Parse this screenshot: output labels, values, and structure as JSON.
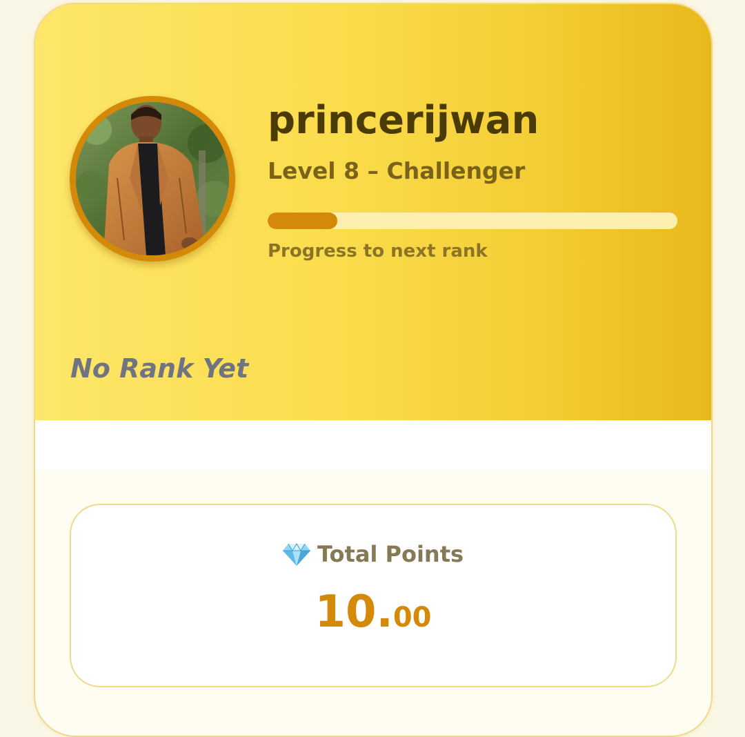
{
  "profile": {
    "username": "princerijwan",
    "level_text": "Level 8 – Challenger",
    "progress_fraction": 0.17,
    "progress_caption": "Progress to next rank",
    "rank_text": "No Rank Yet",
    "avatar_icon": "user-avatar-photo"
  },
  "points": {
    "title": "Total Points",
    "icon": "gem-icon",
    "value_integer": "10.",
    "value_decimal": "00"
  },
  "colors": {
    "accent": "#d48a08",
    "hero_gradient_start": "#fde66a",
    "hero_gradient_end": "#e9b81c",
    "username": "#4a3a05",
    "rank_text": "#6f7480"
  }
}
